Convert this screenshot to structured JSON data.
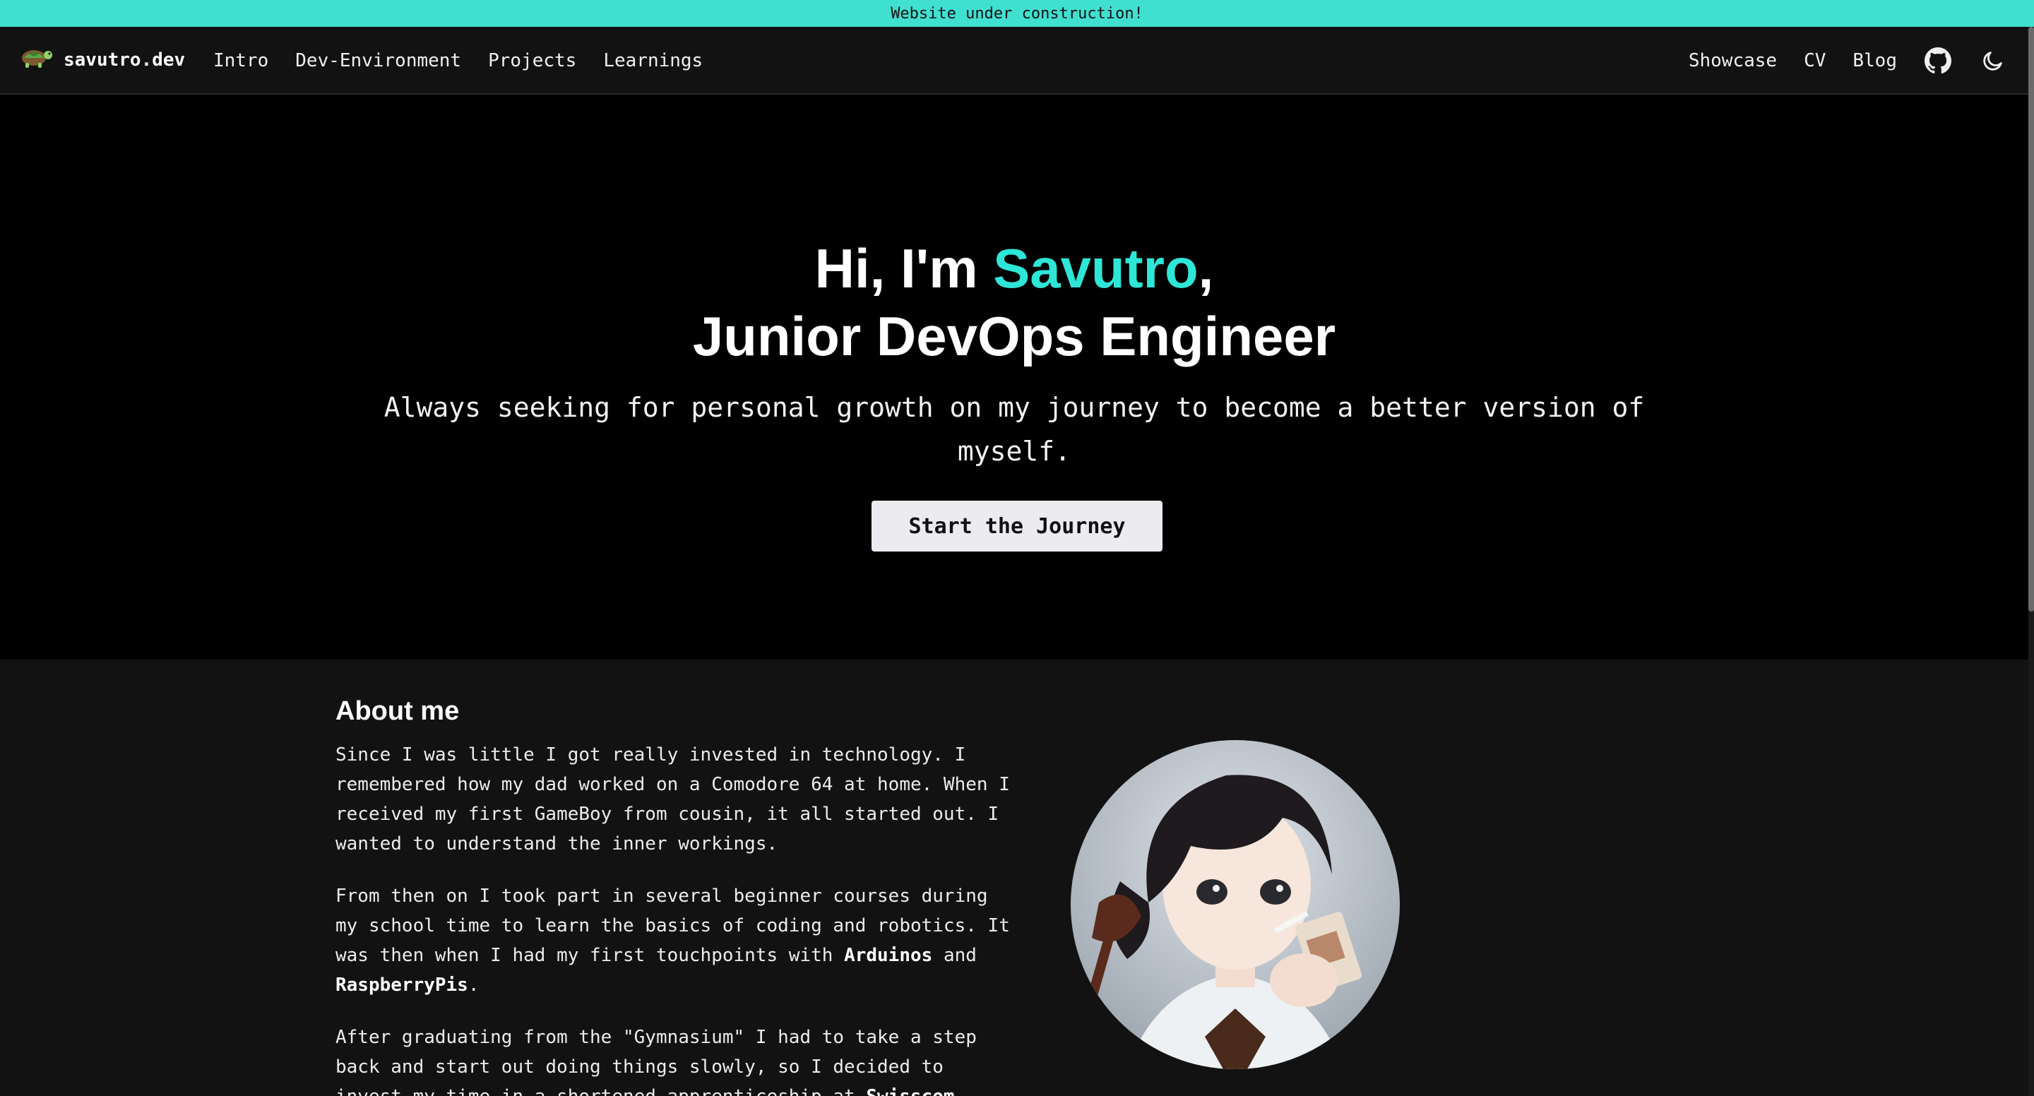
{
  "banner": {
    "text": "Website under construction!"
  },
  "nav": {
    "brand": "savutro.dev",
    "left_links": [
      "Intro",
      "Dev-Environment",
      "Projects",
      "Learnings"
    ],
    "right_links": [
      "Showcase",
      "CV",
      "Blog"
    ],
    "icons": [
      "github-icon",
      "moon-icon"
    ]
  },
  "hero": {
    "greeting_prefix": "Hi, I'm ",
    "name": "Savutro",
    "greeting_suffix": ",",
    "role": "Junior DevOps Engineer",
    "subtitle": "Always seeking for personal growth on my journey to become a better version of myself.",
    "cta_label": "Start the Journey"
  },
  "about": {
    "heading": "About me",
    "p1": "Since I was little I got really invested in technology. I remembered how my dad worked on a Comodore 64 at home. When I received my first GameBoy from cousin, it all started out. I wanted to understand the inner workings.",
    "p2_prefix": "From then on I took part in several beginner courses during my school time to learn the basics of coding and robotics. It was then when I had my first touchpoints with ",
    "p2_bold1": "Arduinos",
    "p2_mid": " and ",
    "p2_bold2": "RaspberryPis",
    "p2_suffix": ".",
    "p3_prefix": "After graduating from the \"Gymnasium\" I had to take a step back and start out doing things slowly, so I decided to invest my time in a shortened apprenticeship at ",
    "p3_bold": "Swisscom",
    "p3_suffix": "."
  },
  "colors": {
    "banner": "#40e0d0",
    "accent": "#2ee6d6",
    "nav_bg": "#121212",
    "hero_bg": "#000000",
    "section_bg": "#121212"
  }
}
